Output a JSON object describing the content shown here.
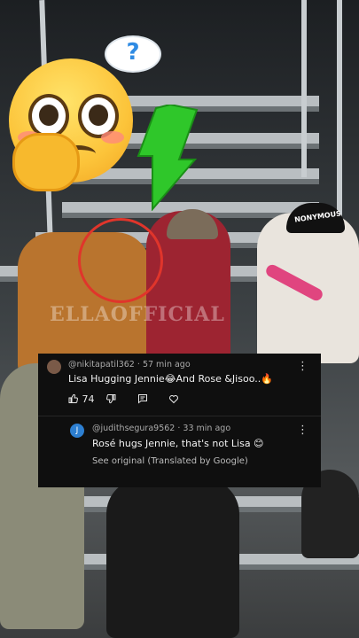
{
  "overlay": {
    "question_mark": "?",
    "watermark": "ELLAOFFICIAL",
    "cap_text": "NONYMOUS"
  },
  "comments": [
    {
      "username": "@nikitapatil362",
      "time": "57 min ago",
      "separator": "·",
      "text": "Lisa Hugging Jennie😂And Rose &Jisoo..🔥",
      "likes": "74",
      "avatar_color": "#7a5a48"
    },
    {
      "username": "@judithsegura9562",
      "time": "33 min ago",
      "separator": "·",
      "avatar_letter": "J",
      "text": "Rosé hugs Jennie, that's not Lisa 😊",
      "see_original": "See original (Translated by Google)",
      "avatar_color": "#2d7fd1"
    }
  ],
  "icons": {
    "more": "⋮",
    "like": "thumbs-up-icon",
    "dislike": "thumbs-down-icon",
    "reply": "reply-icon",
    "heart": "heart-icon"
  },
  "colors": {
    "card_bg": "#0f0f0f",
    "arrow": "#2fc72a",
    "circle": "#e0352b"
  }
}
